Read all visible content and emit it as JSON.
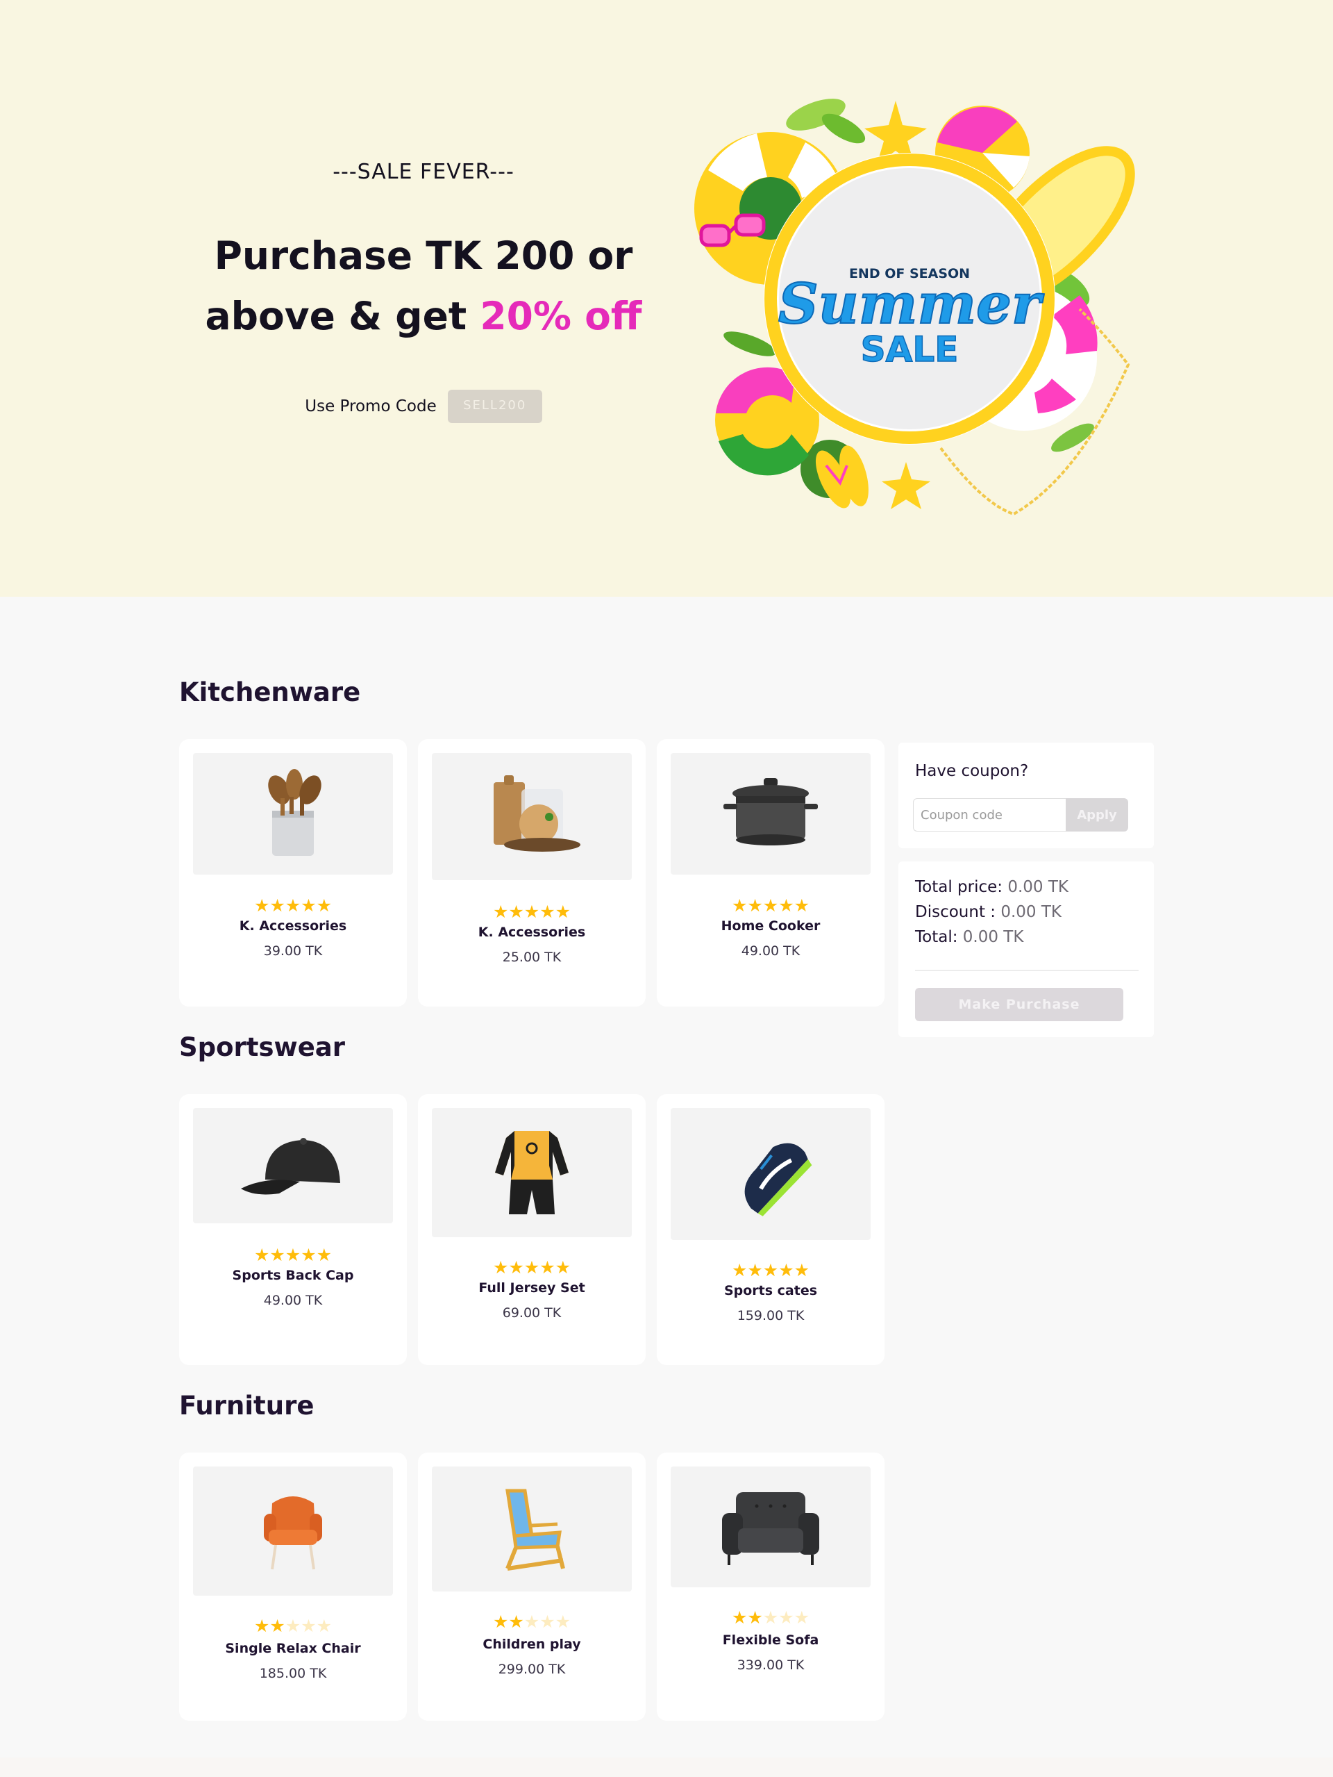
{
  "hero": {
    "eyebrow": "---SALE FEVER---",
    "headline_line1": "Purchase TK 200 or",
    "headline_line2_prefix": "above & get ",
    "headline_highlight": "20% off",
    "promo_label": "Use Promo Code",
    "promo_code": "SELL200",
    "badge_top": "END OF SEASON",
    "badge_script": "Summer",
    "badge_bottom": "SALE",
    "accent_color": "#e52ab9",
    "background_color": "#f9f6e1"
  },
  "categories": [
    {
      "title": "Kitchenware",
      "products": [
        {
          "name": "K. Accessories",
          "price": "39.00 TK",
          "rating": 5,
          "icon": "utensil-holder-icon"
        },
        {
          "name": "K. Accessories",
          "price": "25.00 TK",
          "rating": 5,
          "icon": "cutting-board-icon"
        },
        {
          "name": "Home Cooker",
          "price": "49.00 TK",
          "rating": 5,
          "icon": "cooking-pot-icon"
        }
      ]
    },
    {
      "title": "Sportswear",
      "products": [
        {
          "name": "Sports Back Cap",
          "price": "49.00 TK",
          "rating": 5,
          "icon": "cap-icon"
        },
        {
          "name": "Full Jersey Set",
          "price": "69.00 TK",
          "rating": 5,
          "icon": "jersey-icon"
        },
        {
          "name": "Sports cates",
          "price": "159.00 TK",
          "rating": 5,
          "icon": "sneaker-icon"
        }
      ]
    },
    {
      "title": "Furniture",
      "products": [
        {
          "name": "Single Relax Chair",
          "price": "185.00 TK",
          "rating": 2,
          "icon": "armchair-icon"
        },
        {
          "name": "Children play",
          "price": "299.00 TK",
          "rating": 2,
          "icon": "folding-chair-icon"
        },
        {
          "name": "Flexible Sofa",
          "price": "339.00 TK",
          "rating": 2,
          "icon": "sofa-icon"
        }
      ]
    }
  ],
  "coupon": {
    "title": "Have coupon?",
    "placeholder": "Coupon code",
    "apply_label": "Apply"
  },
  "summary": {
    "total_price_label": "Total price:",
    "total_price_value": "0.00 TK",
    "discount_label": "Discount :",
    "discount_value": "0.00 TK",
    "total_label": "Total:",
    "total_value": "0.00 TK",
    "purchase_label": "Make Purchase"
  },
  "colors": {
    "star": "#ffbc0a",
    "star_empty": "#fdecc0",
    "disabled_button": "#dcd8dc"
  }
}
